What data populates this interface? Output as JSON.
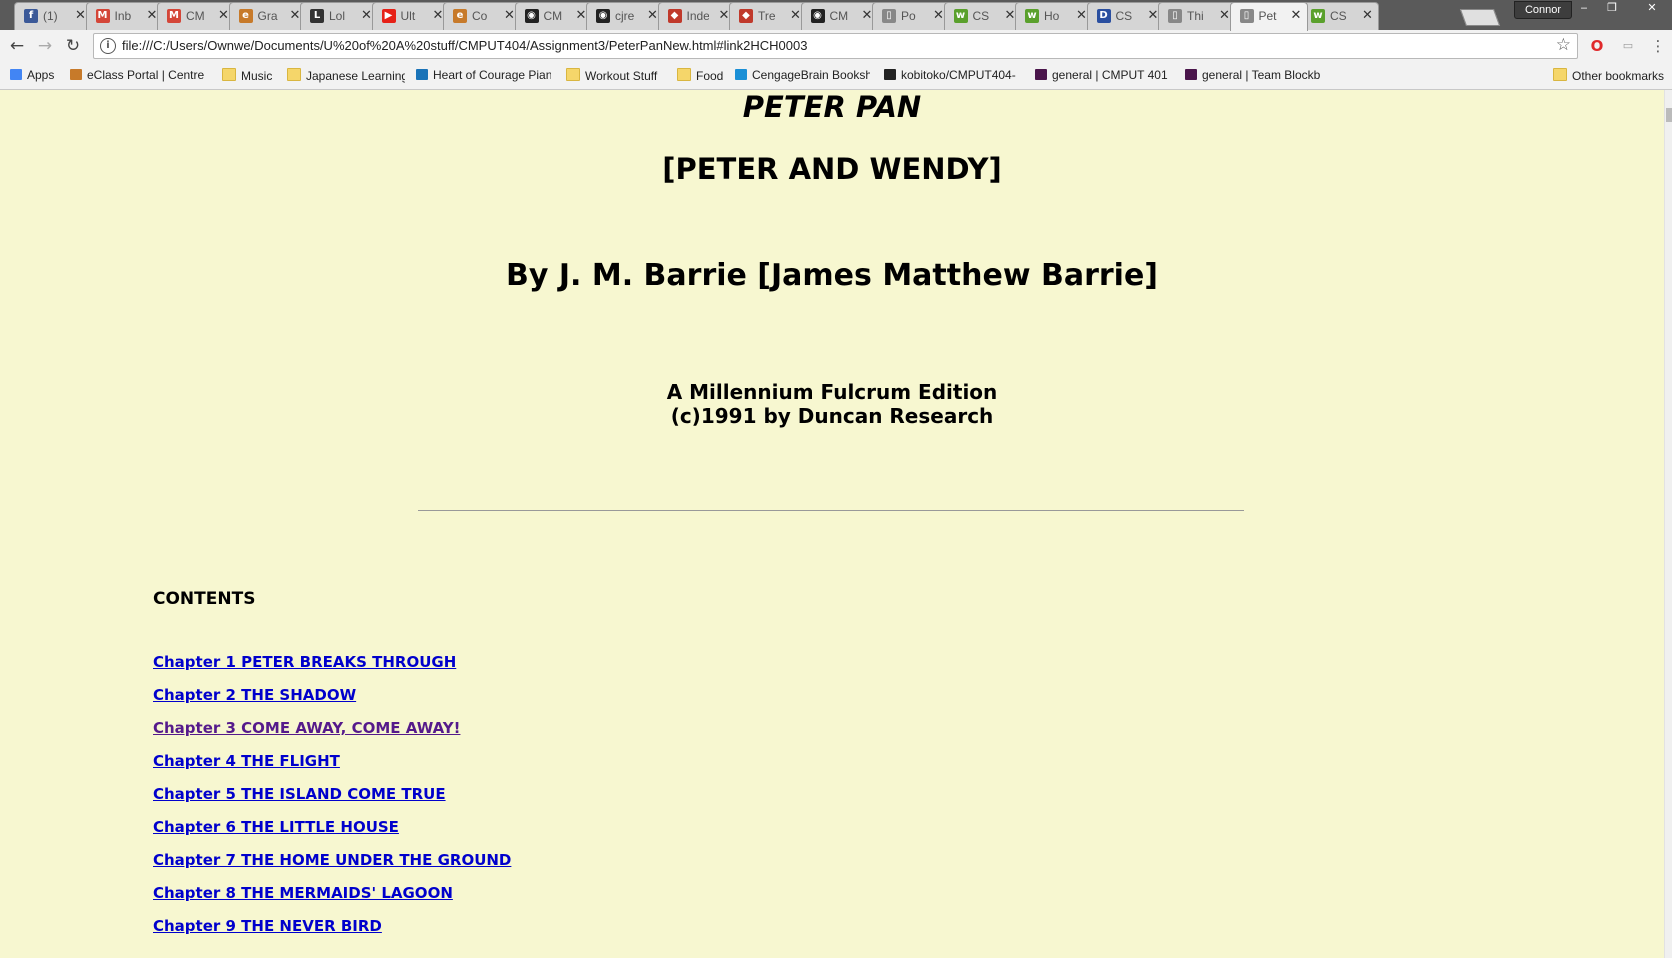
{
  "browser": {
    "tabs": [
      {
        "label": "(1)",
        "icon": "facebook-icon",
        "color": "#3b5998",
        "glyph": "f"
      },
      {
        "label": "Inb",
        "icon": "gmail-icon",
        "color": "#d44638",
        "glyph": "M"
      },
      {
        "label": "CM",
        "icon": "gmail-icon",
        "color": "#d44638",
        "glyph": "M"
      },
      {
        "label": "Gra",
        "icon": "eclass-icon",
        "color": "#c77a2a",
        "glyph": "e"
      },
      {
        "label": "Lol",
        "icon": "shield-icon",
        "color": "#333333",
        "glyph": "L"
      },
      {
        "label": "Ult",
        "icon": "youtube-icon",
        "color": "#e62117",
        "glyph": "▶"
      },
      {
        "label": "Co",
        "icon": "eclass-icon",
        "color": "#c77a2a",
        "glyph": "e"
      },
      {
        "label": "CM",
        "icon": "github-icon",
        "color": "#222222",
        "glyph": "◉"
      },
      {
        "label": "cjre",
        "icon": "github-icon",
        "color": "#222222",
        "glyph": "◉"
      },
      {
        "label": "Inde",
        "icon": "overleaf-icon",
        "color": "#c0392b",
        "glyph": "◆"
      },
      {
        "label": "Tre",
        "icon": "overleaf-icon",
        "color": "#c0392b",
        "glyph": "◆"
      },
      {
        "label": "CM",
        "icon": "github-icon",
        "color": "#222222",
        "glyph": "◉"
      },
      {
        "label": "Po",
        "icon": "page-icon",
        "color": "#888888",
        "glyph": "▯"
      },
      {
        "label": "CS",
        "icon": "webwork-icon",
        "color": "#5aa02c",
        "glyph": "w"
      },
      {
        "label": "Ho",
        "icon": "webwork-icon",
        "color": "#5aa02c",
        "glyph": "w"
      },
      {
        "label": "CS",
        "icon": "dans-icon",
        "color": "#2a4fa0",
        "glyph": "D"
      },
      {
        "label": "Thi",
        "icon": "page-icon",
        "color": "#888888",
        "glyph": "▯"
      },
      {
        "label": "Pet",
        "icon": "page-icon",
        "color": "#888888",
        "glyph": "▯",
        "active": true
      },
      {
        "label": "CS",
        "icon": "webwork-icon",
        "color": "#5aa02c",
        "glyph": "w"
      }
    ],
    "profile_name": "Connor",
    "url": "file:///C:/Users/Ownwe/Documents/U%20of%20A%20stuff/CMPUT404/Assignment3/PeterPanNew.html#link2HCH0003",
    "bookmarks": [
      {
        "label": "Apps",
        "icon": "apps-icon",
        "color": "#4285f4"
      },
      {
        "label": "eClass Portal | Centre",
        "icon": "eclass-icon",
        "color": "#c77a2a"
      },
      {
        "label": "Music",
        "icon": "folder-icon",
        "color": "#f5d66a"
      },
      {
        "label": "Japanese Learning",
        "icon": "folder-icon",
        "color": "#f5d66a"
      },
      {
        "label": "Heart of Courage Pian",
        "icon": "musescore-icon",
        "color": "#1a73b8"
      },
      {
        "label": "Workout Stuff",
        "icon": "folder-icon",
        "color": "#f5d66a"
      },
      {
        "label": "Food",
        "icon": "folder-icon",
        "color": "#f5d66a"
      },
      {
        "label": "CengageBrain Booksh",
        "icon": "cengage-icon",
        "color": "#1a8fd6"
      },
      {
        "label": "kobitoko/CMPUT404-",
        "icon": "github-icon",
        "color": "#222222"
      },
      {
        "label": "general | CMPUT 401",
        "icon": "slack-icon",
        "color": "#4a154b"
      },
      {
        "label": "general | Team Blockb",
        "icon": "slack-icon",
        "color": "#4a154b"
      }
    ],
    "other_bookmarks": "Other bookmarks"
  },
  "page": {
    "title": "PETER PAN",
    "subtitle": "[PETER AND WENDY]",
    "author": "By J. M. Barrie [James Matthew Barrie]",
    "edition_line1": "A Millennium Fulcrum Edition",
    "edition_line2": "(c)1991 by Duncan Research",
    "contents_heading": "CONTENTS",
    "chapters": [
      {
        "label": "Chapter 1 PETER BREAKS THROUGH",
        "visited": false
      },
      {
        "label": "Chapter 2 THE SHADOW",
        "visited": false
      },
      {
        "label": "Chapter 3 COME AWAY, COME AWAY!",
        "visited": true
      },
      {
        "label": "Chapter 4 THE FLIGHT",
        "visited": false
      },
      {
        "label": "Chapter 5 THE ISLAND COME TRUE",
        "visited": false
      },
      {
        "label": "Chapter 6 THE LITTLE HOUSE",
        "visited": false
      },
      {
        "label": "Chapter 7 THE HOME UNDER THE GROUND",
        "visited": false
      },
      {
        "label": "Chapter 8 THE MERMAIDS' LAGOON",
        "visited": false
      },
      {
        "label": "Chapter 9 THE NEVER BIRD",
        "visited": false
      }
    ]
  },
  "colors": {
    "page_background": "#f7f7d0",
    "link": "#0000cc",
    "visited_link": "#551a8b"
  }
}
